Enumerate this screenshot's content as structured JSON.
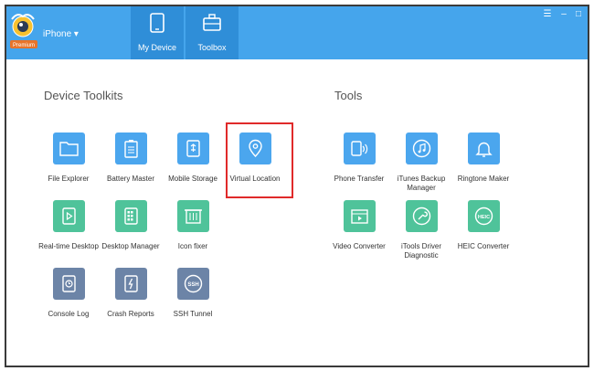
{
  "header": {
    "device": "iPhone",
    "badge": "Premium",
    "tabs": [
      {
        "label": "My Device",
        "icon": "tablet-icon"
      },
      {
        "label": "Toolbox",
        "icon": "toolbox-icon"
      }
    ],
    "window_controls": [
      "menu-icon",
      "minimize-icon",
      "maximize-icon"
    ]
  },
  "sections": {
    "device_toolkits": {
      "title": "Device Toolkits",
      "items": [
        {
          "label": "File Explorer",
          "icon": "folder-icon",
          "color": "#4ba6ee"
        },
        {
          "label": "Battery Master",
          "icon": "battery-icon",
          "color": "#4ba6ee"
        },
        {
          "label": "Mobile Storage",
          "icon": "usb-storage-icon",
          "color": "#4ba6ee"
        },
        {
          "label": "Virtual Location",
          "icon": "location-pin-icon",
          "color": "#4ba6ee"
        },
        {
          "label": "Real-time Desktop",
          "icon": "play-icon",
          "color": "#4fc39a"
        },
        {
          "label": "Desktop Manager",
          "icon": "grid-icon",
          "color": "#4fc39a"
        },
        {
          "label": "Icon fixer",
          "icon": "trash-icon",
          "color": "#4fc39a"
        },
        {
          "label": "Console Log",
          "icon": "clock-log-icon",
          "color": "#6c84a7"
        },
        {
          "label": "Crash Reports",
          "icon": "lightning-icon",
          "color": "#6c84a7"
        },
        {
          "label": "SSH Tunnel",
          "icon": "ssh-icon",
          "color": "#6c84a7",
          "ssh_text": "SSH"
        }
      ]
    },
    "tools": {
      "title": "Tools",
      "items": [
        {
          "label": "Phone Transfer",
          "icon": "phone-transfer-icon",
          "color": "#4ba6ee"
        },
        {
          "label": "iTunes Backup Manager",
          "icon": "music-icon",
          "color": "#4ba6ee"
        },
        {
          "label": "Ringtone Maker",
          "icon": "bell-icon",
          "color": "#4ba6ee"
        },
        {
          "label": "Video Converter",
          "icon": "video-icon",
          "color": "#4fc39a"
        },
        {
          "label": "iTools Driver Diagnostic",
          "icon": "wrench-icon",
          "color": "#4fc39a"
        },
        {
          "label": "HEIC Converter",
          "icon": "heic-icon",
          "color": "#4fc39a",
          "heic_text": "HEIC"
        }
      ]
    }
  }
}
